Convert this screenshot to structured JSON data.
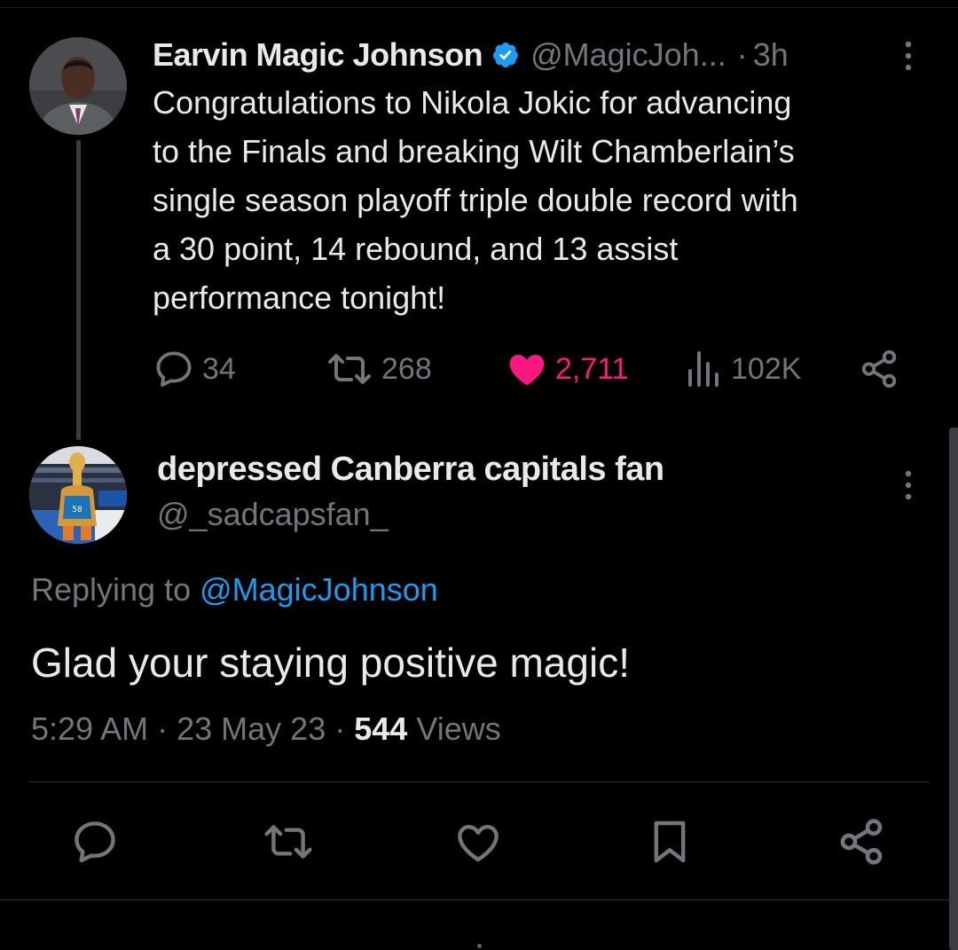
{
  "parent_tweet": {
    "display_name": "Earvin Magic Johnson",
    "handle": "@MagicJoh...",
    "separator": "·",
    "time_ago": "3h",
    "text_lines": [
      "Congratulations to Nikola Jokic for advancing",
      "to the Finals and breaking Wilt Chamberlain’s",
      "single season playoff triple double record with",
      "a 30 point, 14 rebound, and 13 assist",
      "performance tonight!"
    ],
    "stats": {
      "replies": "34",
      "retweets": "268",
      "likes": "2,711",
      "views": "102K"
    },
    "verified": true,
    "liked": true
  },
  "reply_tweet": {
    "display_name": "depressed Canberra capitals fan",
    "handle": "@_sadcapsfan_",
    "replying_prefix": "Replying to ",
    "replying_to": "@MagicJohnson",
    "text": "Glad your staying positive magic!",
    "time": "5:29 AM",
    "date": "23 May 23",
    "separator": "·",
    "views_count": "544",
    "views_label": "Views"
  },
  "icons": {
    "verified": "verified-badge-icon",
    "more": "more-vertical-icon",
    "reply": "reply-bubble-icon",
    "retweet": "retweet-icon",
    "like": "heart-icon",
    "views": "bar-chart-icon",
    "share": "share-icon",
    "bookmark": "bookmark-icon"
  },
  "colors": {
    "background": "#000000",
    "text": "#e7e9ea",
    "muted": "#71767b",
    "link": "#1d9bf0",
    "like_active": "#f91880",
    "verified": "#1d9bf0"
  }
}
